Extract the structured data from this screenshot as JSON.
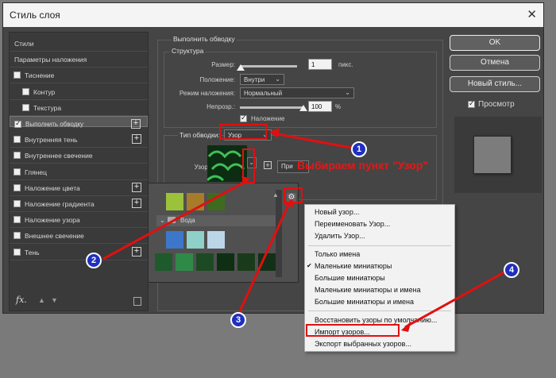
{
  "dialog": {
    "title": "Стиль слоя",
    "close_glyph": "✕"
  },
  "sidebar": {
    "items": [
      {
        "label": "Стили",
        "checkbox": false,
        "checked": false,
        "plus": false
      },
      {
        "label": "Параметры наложения",
        "checkbox": false,
        "checked": false,
        "plus": false
      },
      {
        "label": "Тиснение",
        "checkbox": true,
        "checked": false,
        "plus": false
      },
      {
        "label": "Контур",
        "checkbox": true,
        "checked": false,
        "plus": false
      },
      {
        "label": "Текстура",
        "checkbox": true,
        "checked": false,
        "plus": false
      },
      {
        "label": "Выполнить обводку",
        "checkbox": true,
        "checked": true,
        "plus": true
      },
      {
        "label": "Внутренняя тень",
        "checkbox": true,
        "checked": false,
        "plus": true
      },
      {
        "label": "Внутреннее свечение",
        "checkbox": true,
        "checked": false,
        "plus": false
      },
      {
        "label": "Глянец",
        "checkbox": true,
        "checked": false,
        "plus": false
      },
      {
        "label": "Наложение цвета",
        "checkbox": true,
        "checked": false,
        "plus": true
      },
      {
        "label": "Наложение градиента",
        "checkbox": true,
        "checked": false,
        "plus": true
      },
      {
        "label": "Наложение узора",
        "checkbox": true,
        "checked": false,
        "plus": false
      },
      {
        "label": "Внешнее свечение",
        "checkbox": true,
        "checked": false,
        "plus": false
      },
      {
        "label": "Тень",
        "checkbox": true,
        "checked": false,
        "plus": true
      }
    ],
    "footer_fx": "fx."
  },
  "stroke": {
    "section_title": "Выполнить обводку",
    "structure_title": "Структура",
    "size_label": "Размер:",
    "size_value": "1",
    "size_unit": "пикс.",
    "position_label": "Положение:",
    "position_value": "Внутри",
    "blend_label": "Режим наложения:",
    "blend_value": "Нормальный",
    "opacity_label": "Непрозр.:",
    "opacity_value": "100",
    "opacity_unit": "%",
    "overprint_label": "Наложение",
    "fill_type_label": "Тип обводки:",
    "fill_type_value": "Узор",
    "pattern_label": "Узор:",
    "snap_button": "При"
  },
  "buttons": {
    "ok": "OK",
    "cancel": "Отмена",
    "new_style": "Новый стиль...",
    "preview_label": "Просмотр"
  },
  "pattern_popup": {
    "group_label": "Вода"
  },
  "menu": {
    "items": [
      {
        "label": "Новый узор...",
        "checked": false
      },
      {
        "label": "Переименовать Узор...",
        "checked": false
      },
      {
        "label": "Удалить Узор...",
        "checked": false
      },
      {
        "label": "Только имена",
        "checked": false
      },
      {
        "label": "Маленькие миниатюры",
        "checked": true
      },
      {
        "label": "Большие миниатюры",
        "checked": false
      },
      {
        "label": "Маленькие миниатюры и имена",
        "checked": false
      },
      {
        "label": "Большие миниатюры и имена",
        "checked": false
      },
      {
        "label": "Восстановить узоры по умолчанию...",
        "checked": false
      },
      {
        "label": "Импорт узоров...",
        "checked": false
      },
      {
        "label": "Экспорт выбранных узоров...",
        "checked": false
      }
    ]
  },
  "annotations": {
    "caption": "Выбираем пункт  \"Узор\"",
    "markers": [
      "1",
      "2",
      "3",
      "4"
    ],
    "color": "#e11919"
  }
}
